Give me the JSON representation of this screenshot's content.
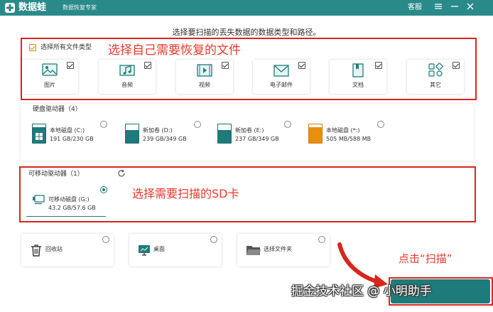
{
  "titlebar": {
    "app_name": "数据蛙",
    "subtitle": "数据恢复专家",
    "service_label": "客服",
    "menu_icon": "menu-icon",
    "minimize_icon": "minimize-icon",
    "close_icon": "close-icon"
  },
  "heading": "选择要扫描的丢失数据的数据类型和路径。",
  "file_types": {
    "select_all_label": "选择所有文件类型",
    "select_all_checked": true,
    "items": [
      {
        "label": "图片",
        "icon": "image-icon",
        "checked": true
      },
      {
        "label": "音频",
        "icon": "music-icon",
        "checked": true
      },
      {
        "label": "视频",
        "icon": "video-icon",
        "checked": true
      },
      {
        "label": "电子邮件",
        "icon": "email-icon",
        "checked": true
      },
      {
        "label": "文档",
        "icon": "document-icon",
        "checked": true
      },
      {
        "label": "其它",
        "icon": "other-icon",
        "checked": true
      }
    ]
  },
  "hard_drives": {
    "title": "硬盘驱动器（4）",
    "drives": [
      {
        "name": "本地磁盘 (C:)",
        "capacity": "191 GB/230 GB",
        "used": 0.83,
        "os_drive": true
      },
      {
        "name": "新加卷 (D:)",
        "capacity": "239 GB/349 GB",
        "used": 0.68
      },
      {
        "name": "新加卷 (E:)",
        "capacity": "237 GB/349 GB",
        "used": 0.68
      },
      {
        "name": "本地磁盘 (*:)",
        "capacity": "505 MB/588 MB",
        "used": 0.86,
        "warning": true
      }
    ]
  },
  "removable": {
    "title": "可移动驱动器（1）",
    "refresh_icon": "refresh-icon",
    "drives": [
      {
        "name": "可移动磁盘 (G:)",
        "capacity": "43.2 GB/57.6 GB",
        "selected": true
      }
    ]
  },
  "locations": [
    {
      "label": "回收站",
      "icon": "recycle-bin-icon"
    },
    {
      "label": "桌面",
      "icon": "desktop-icon"
    },
    {
      "label": "选择文件夹",
      "icon": "folder-icon"
    }
  ],
  "annotations": {
    "file_types": "选择自己需要恢复的文件",
    "sd_card": "选择需要扫描的SD卡",
    "click_scan": "点击“扫描”"
  },
  "watermark": "掘金技术社区 @ 小明助手",
  "colors": {
    "accent": "#1e7b7b",
    "titlebar": "#2a8a8a",
    "annotation": "#e8392a",
    "warning": "#e8900e"
  }
}
